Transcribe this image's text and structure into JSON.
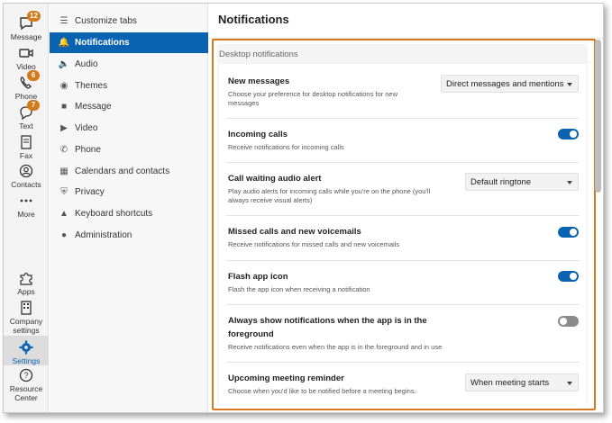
{
  "rail": {
    "items": [
      {
        "label": "Message",
        "badge": "12"
      },
      {
        "label": "Video"
      },
      {
        "label": "Phone",
        "badge": "6"
      },
      {
        "label": "Text",
        "badge": "7"
      },
      {
        "label": "Fax"
      },
      {
        "label": "Contacts"
      },
      {
        "label": "More"
      },
      {
        "label": "Apps"
      },
      {
        "label": "Company settings"
      },
      {
        "label": "Settings"
      },
      {
        "label": "Resource Center"
      }
    ]
  },
  "nav": {
    "items": [
      {
        "label": "Customize tabs"
      },
      {
        "label": "Notifications"
      },
      {
        "label": "Audio"
      },
      {
        "label": "Themes"
      },
      {
        "label": "Message"
      },
      {
        "label": "Video"
      },
      {
        "label": "Phone"
      },
      {
        "label": "Calendars and contacts"
      },
      {
        "label": "Privacy"
      },
      {
        "label": "Keyboard shortcuts"
      },
      {
        "label": "Administration"
      }
    ]
  },
  "main": {
    "title": "Notifications",
    "section": "Desktop notifications",
    "settings": [
      {
        "name": "New messages",
        "desc": "Choose your preference for desktop notifications for new messages",
        "control": "select",
        "value": "Direct messages and mentions"
      },
      {
        "name": "Incoming calls",
        "desc": "Receive notifications for incoming calls",
        "control": "toggle",
        "on": true
      },
      {
        "name": "Call waiting audio alert",
        "desc": "Play audio alerts for incoming calls while you're on the phone (you'll always receive visual alerts)",
        "control": "select",
        "value": "Default ringtone"
      },
      {
        "name": "Missed calls and new voicemails",
        "desc": "Receive notifications for missed calls and new voicemails",
        "control": "toggle",
        "on": true
      },
      {
        "name": "Flash app icon",
        "desc": "Flash the app icon when receiving a notification",
        "control": "toggle",
        "on": true
      },
      {
        "name": "Always show notifications when the app is in the foreground",
        "desc": "Receive notifications even when the app is in the foreground and in use",
        "control": "toggle",
        "on": false
      },
      {
        "name": "Upcoming meeting reminder",
        "desc": "Choose when you'd like to be notified before a meeting begins.",
        "control": "select",
        "value": "When meeting starts"
      }
    ]
  },
  "colors": {
    "accent": "#0a63b0",
    "highlight": "#d47a1c",
    "badge": "#d47a1c"
  }
}
